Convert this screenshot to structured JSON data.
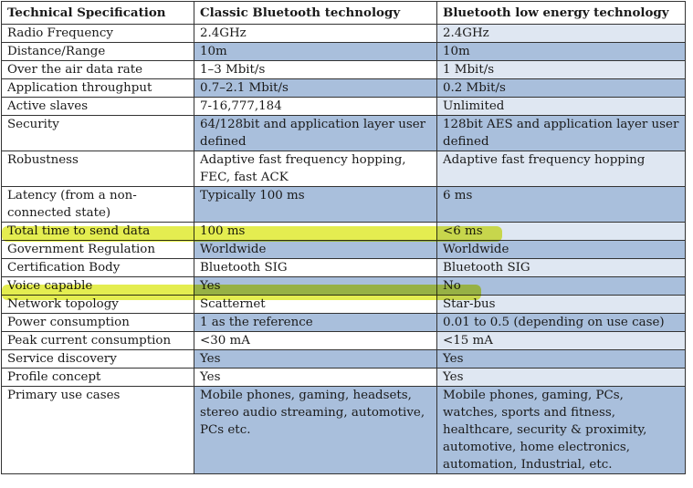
{
  "headers": [
    "Technical Specification",
    "Classic Bluetooth technology",
    "Bluetooth low energy technology"
  ],
  "rows": [
    {
      "spec": "Radio Frequency",
      "classic": "2.4GHz",
      "le": "2.4GHz"
    },
    {
      "spec": "Distance/Range",
      "classic": "10m",
      "le": "10m"
    },
    {
      "spec": "Over the air data rate",
      "classic": "1–3 Mbit/s",
      "le": "1 Mbit/s"
    },
    {
      "spec": "Application throughput",
      "classic": "0.7–2.1 Mbit/s",
      "le": "0.2 Mbit/s"
    },
    {
      "spec": "Active slaves",
      "classic": "7-16,777,184",
      "le": "Unlimited"
    },
    {
      "spec": "Security",
      "classic": "64/128bit and application layer user defined",
      "le": "128bit AES and application layer user defined"
    },
    {
      "spec": "Robustness",
      "classic": "Adaptive fast frequency hopping, FEC, fast ACK",
      "le": "Adaptive fast frequency hopping"
    },
    {
      "spec": "Latency (from a non-connected state)",
      "classic": "Typically 100 ms",
      "le": "6 ms"
    },
    {
      "spec": "Total time to send data",
      "classic": "100 ms",
      "le": "<6 ms"
    },
    {
      "spec": "Government Regulation",
      "classic": "Worldwide",
      "le": "Worldwide"
    },
    {
      "spec": "Certification Body",
      "classic": "Bluetooth SIG",
      "le": "Bluetooth SIG"
    },
    {
      "spec": "Voice capable",
      "classic": "Yes",
      "le": "No"
    },
    {
      "spec": "Network topology",
      "classic": "Scatternet",
      "le": "Star-bus"
    },
    {
      "spec": "Power consumption",
      "classic": "1 as the reference",
      "le": "0.01 to 0.5 (depending on use case)"
    },
    {
      "spec": "Peak current consumption",
      "classic": "<30 mA",
      "le": "<15 mA"
    },
    {
      "spec": "Service discovery",
      "classic": "Yes",
      "le": "Yes"
    },
    {
      "spec": "Profile concept",
      "classic": "Yes",
      "le": "Yes"
    },
    {
      "spec": "Primary use cases",
      "classic": "Mobile phones, gaming, headsets, stereo audio streaming, automotive, PCs etc.",
      "le": "Mobile phones, gaming, PCs, watches, sports and fitness, healthcare, security & proximity, automotive, home electronics, automation, Industrial, etc."
    }
  ],
  "highlight_color": "#dce81e",
  "alt_row_color": "#a9bfdc",
  "light_cell_color": "#dfe7f2"
}
